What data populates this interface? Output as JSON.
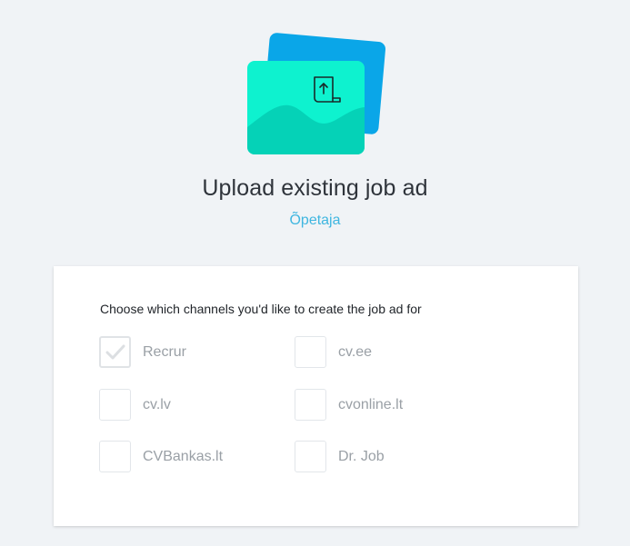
{
  "header": {
    "title": "Upload existing job ad",
    "subtitle": "Õpetaja",
    "illustration_icon": "upload-document-icon"
  },
  "card": {
    "prompt": "Choose which channels you'd like to create the job ad for",
    "channels": [
      {
        "label": "Recrur",
        "checked": true
      },
      {
        "label": "cv.ee",
        "checked": false
      },
      {
        "label": "cv.lv",
        "checked": false
      },
      {
        "label": "cvonline.lt",
        "checked": false
      },
      {
        "label": "CVBankas.lt",
        "checked": false
      },
      {
        "label": "Dr. Job",
        "checked": false
      }
    ]
  },
  "colors": {
    "background": "#f0f3f6",
    "accent": "#3fb6e0",
    "illustration_front": "#0ff0c8",
    "illustration_back": "#0aa6e8"
  }
}
